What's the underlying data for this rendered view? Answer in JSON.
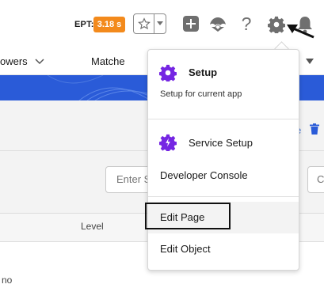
{
  "header": {
    "ept_label": "EPT:",
    "ept_value": "3.18 s",
    "icons": [
      "star-icon",
      "chevron-down-icon",
      "plus-icon",
      "trailhead-icon",
      "help-icon",
      "gear-icon",
      "bell-icon"
    ],
    "help_glyph": "?"
  },
  "nav": {
    "items": [
      {
        "label": "owers"
      },
      {
        "label": "Matche"
      }
    ]
  },
  "menu": {
    "setup_title": "Setup",
    "setup_desc": "Setup for current app",
    "service_setup": "Service Setup",
    "developer_console": "Developer Console",
    "edit_page": "Edit Page",
    "edit_object": "Edit Object"
  },
  "content": {
    "input_placeholder": "Enter S",
    "right_button_text": "C",
    "column_level": "Level",
    "bottom_text": "no"
  },
  "colors": {
    "accent": "#f38a1c",
    "setup_icon": "#7526e3",
    "banner": "#2a5bd8"
  }
}
